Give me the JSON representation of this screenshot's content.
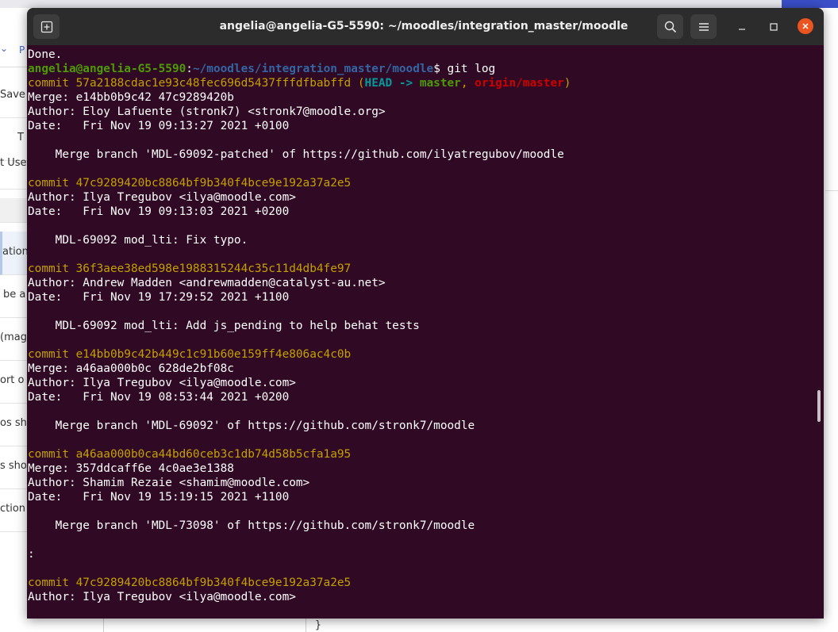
{
  "background": {
    "nav_letter": "P",
    "sidebar": [
      "Save c",
      "T",
      "t Use",
      "",
      "ation",
      "be a",
      "(mag",
      "ort o",
      "os sho",
      "s shou",
      "ction t"
    ],
    "bottom_brace": "}"
  },
  "terminal": {
    "title": "angelia@angelia-G5-5590: ~/moodles/integration_master/moodle",
    "lines": {
      "l01": "Done.",
      "l02_user": "angelia@angelia-G5-5590",
      "l02_colon": ":",
      "l02_path": "~/moodles/integration_master/moodle",
      "l02_cmd": "$ git log",
      "l03_hash": "commit 57a2188cdac1e93c48fec696d5437fffdfbabffd",
      "l03_open": " (",
      "l03_head": "HEAD -> ",
      "l03_master": "master",
      "l03_sep": ", ",
      "l03_origin": "origin/master",
      "l03_close": ")",
      "l04": "Merge: e14bb0b9c42 47c9289420b",
      "l05": "Author: Eloy Lafuente (stronk7) <stronk7@moodle.org>",
      "l06": "Date:   Fri Nov 19 09:13:27 2021 +0100",
      "l07": "",
      "l08": "    Merge branch 'MDL-69092-patched' of https://github.com/ilyatregubov/moodle",
      "l09": "",
      "l10": "commit 47c9289420bc8864bf9b340f4bce9e192a37a2e5",
      "l11": "Author: Ilya Tregubov <ilya@moodle.com>",
      "l12": "Date:   Fri Nov 19 09:13:03 2021 +0200",
      "l13": "",
      "l14": "    MDL-69092 mod_lti: Fix typo.",
      "l15": "",
      "l16": "commit 36f3aee38ed598e1988315244c35c11d4db4fe97",
      "l17": "Author: Andrew Madden <andrewmadden@catalyst-au.net>",
      "l18": "Date:   Fri Nov 19 17:29:52 2021 +1100",
      "l19": "",
      "l20": "    MDL-69092 mod_lti: Add js_pending to help behat tests",
      "l21": "",
      "l22": "commit e14bb0b9c42b449c1c91b60e159ff4e806ac4c0b",
      "l23": "Merge: a46aa000b0c 628de2bf08c",
      "l24": "Author: Ilya Tregubov <ilya@moodle.com>",
      "l25": "Date:   Fri Nov 19 08:53:44 2021 +0200",
      "l26": "",
      "l27": "    Merge branch 'MDL-69092' of https://github.com/stronk7/moodle",
      "l28": "",
      "l29": "commit a46aa000b0ca44bd60ceb3c1db74d58b5cfa1a95",
      "l30": "Merge: 357ddcaff6e 4c0ae3e1388",
      "l31": "Author: Shamim Rezaie <shamim@moodle.com>",
      "l32": "Date:   Fri Nov 19 15:19:15 2021 +1100",
      "l33": "",
      "l34": "    Merge branch 'MDL-73098' of https://github.com/stronk7/moodle",
      "l35": "",
      "l36": ":",
      "l37": "",
      "l38": "commit 47c9289420bc8864bf9b340f4bce9e192a37a2e5",
      "l39": "Author: Ilya Tregubov <ilya@moodle.com>"
    }
  },
  "colors": {
    "terminal_bg": "#300a24",
    "commit_hash": "#c4a000",
    "prompt_user": "#4e9a06",
    "prompt_path": "#3465a4",
    "close_button": "#e95420"
  },
  "icons": [
    "new-tab-icon",
    "search-icon",
    "hamburger-menu-icon",
    "minimize-icon",
    "maximize-icon",
    "close-icon"
  ]
}
